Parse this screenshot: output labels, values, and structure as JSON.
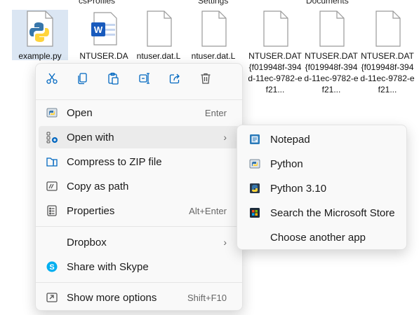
{
  "header_labels": [
    "csProfiles",
    "Settings",
    "Documents"
  ],
  "files": [
    {
      "name": "example.py",
      "selected": true,
      "icon": "python-file-icon"
    },
    {
      "name": "NTUSER.DA",
      "icon": "word-file-icon"
    },
    {
      "name": "ntuser.dat.L",
      "icon": "blank-file-icon"
    },
    {
      "name": "ntuser.dat.L",
      "icon": "blank-file-icon"
    },
    {
      "name": "NTUSER.DAT{f019948f-394d-11ec-9782-ef21...",
      "icon": "blank-file-icon"
    },
    {
      "name": "NTUSER.DAT{f019948f-394d-11ec-9782-ef21...",
      "icon": "blank-file-icon"
    },
    {
      "name": "NTUSER.DAT{f019948f-394d-11ec-9782-ef21...",
      "icon": "blank-file-icon"
    }
  ],
  "quick_actions": [
    "cut-icon",
    "copy-icon",
    "paste-icon",
    "rename-icon",
    "share-icon",
    "delete-icon"
  ],
  "menu": {
    "open": {
      "label": "Open",
      "shortcut": "Enter"
    },
    "open_with": {
      "label": "Open with"
    },
    "compress": {
      "label": "Compress to ZIP file"
    },
    "copy_path": {
      "label": "Copy as path"
    },
    "properties": {
      "label": "Properties",
      "shortcut": "Alt+Enter"
    },
    "dropbox": {
      "label": "Dropbox"
    },
    "skype": {
      "label": "Share with Skype"
    },
    "more": {
      "label": "Show more options",
      "shortcut": "Shift+F10"
    }
  },
  "submenu": {
    "notepad": "Notepad",
    "python": "Python",
    "python310": "Python 3.10",
    "store": "Search the Microsoft Store",
    "choose": "Choose another app"
  },
  "colors": {
    "accent": "#0067c0",
    "selected_bg": "#dbe6f3",
    "python_blue": "#3776ab",
    "python_yellow": "#ffd43b"
  }
}
